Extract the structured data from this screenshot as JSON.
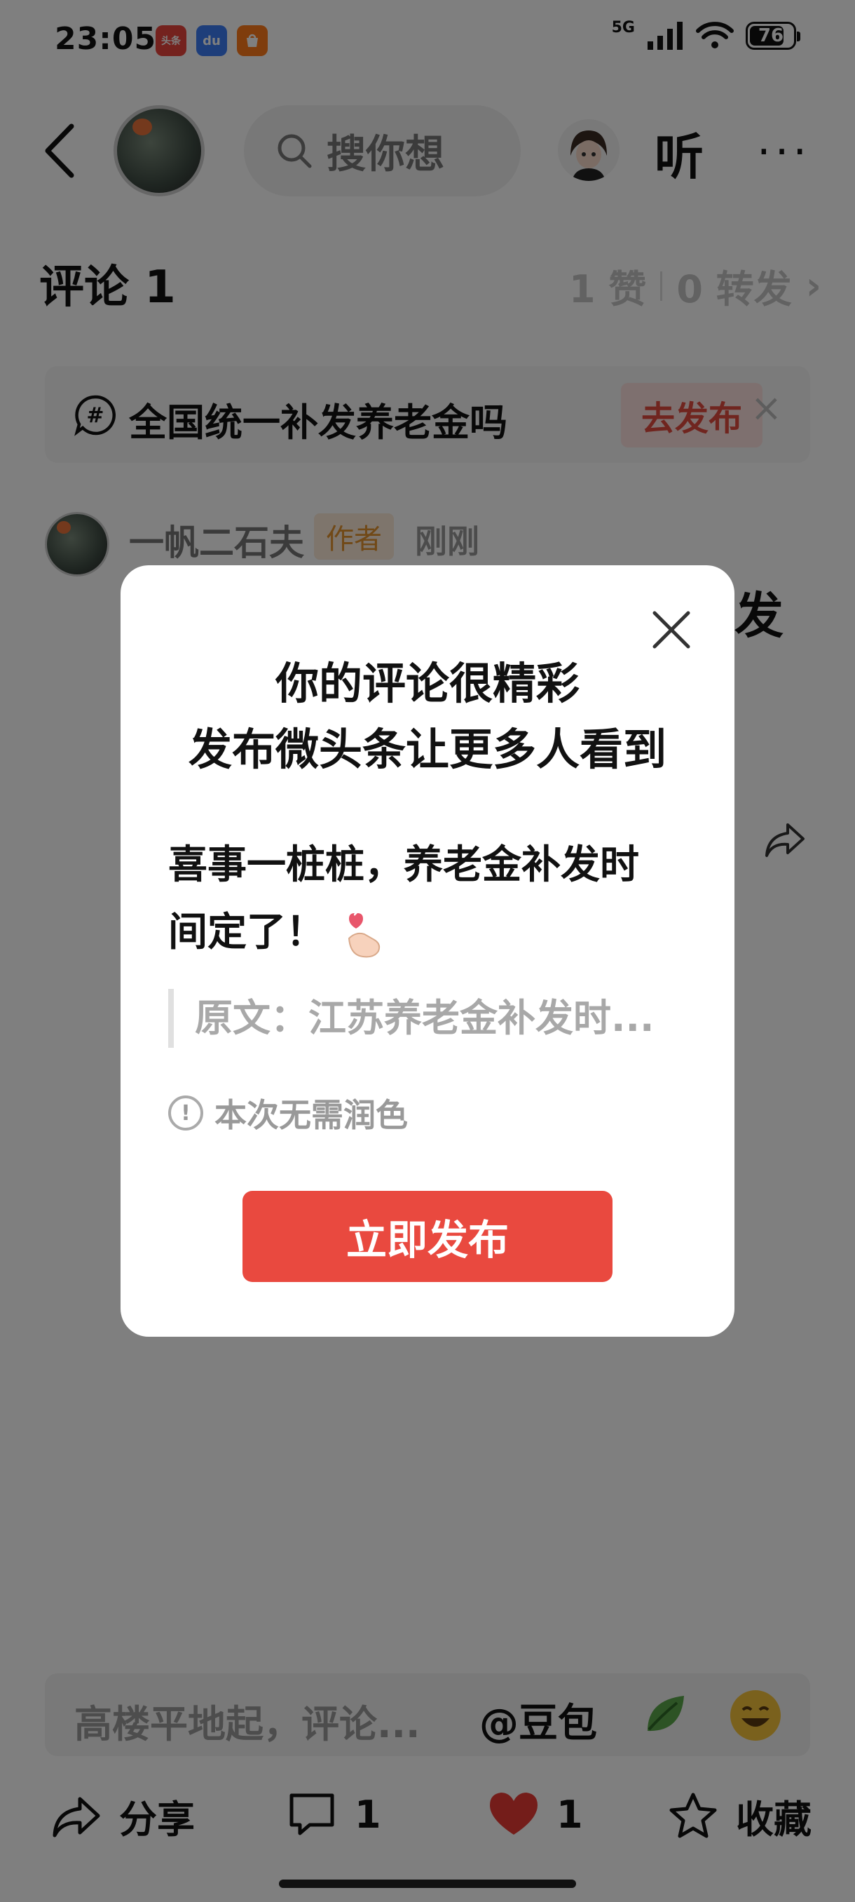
{
  "status_bar": {
    "time": "23:05",
    "apps": [
      {
        "icon": "toutiao-app-icon",
        "label": "头条",
        "color": "#e8453c"
      },
      {
        "icon": "baidu-app-icon",
        "label": "du",
        "color": "#3d7cf4"
      },
      {
        "icon": "store-app-icon",
        "label": "",
        "color": "#ff7a1a"
      }
    ],
    "network": "5G",
    "battery": "76"
  },
  "header": {
    "search_text": "搜你想",
    "listen_label": "听",
    "more_label": "···"
  },
  "comments": {
    "title": "评论 1",
    "likes": "1 赞",
    "reposts": "0 转发",
    "chevron": "›"
  },
  "topic": {
    "text": "全国统一补发养老金吗",
    "go_label": "去发布",
    "close_label": "×"
  },
  "comment": {
    "name": "一帆二石夫",
    "badge": "作者",
    "time": "刚刚",
    "text_tail": "发"
  },
  "modal": {
    "title_line1": "你的评论很精彩",
    "title_line2": "发布微头条让更多人看到",
    "body_line1": "喜事一桩桩，养老金补发时",
    "body_line2": "间定了！",
    "quote": "原文：江苏养老金补发时...",
    "note": "本次无需润色",
    "publish_label": "立即发布"
  },
  "input_bar": {
    "placeholder": "高楼平地起，评论...",
    "mention": "@豆包"
  },
  "actions": {
    "share": "分享",
    "comment_count": "1",
    "like_count": "1",
    "favorite": "收藏"
  },
  "colors": {
    "accent_red": "#e9493f",
    "author_badge": "#e3932e",
    "overlay": "rgba(0,0,0,0.5)"
  }
}
